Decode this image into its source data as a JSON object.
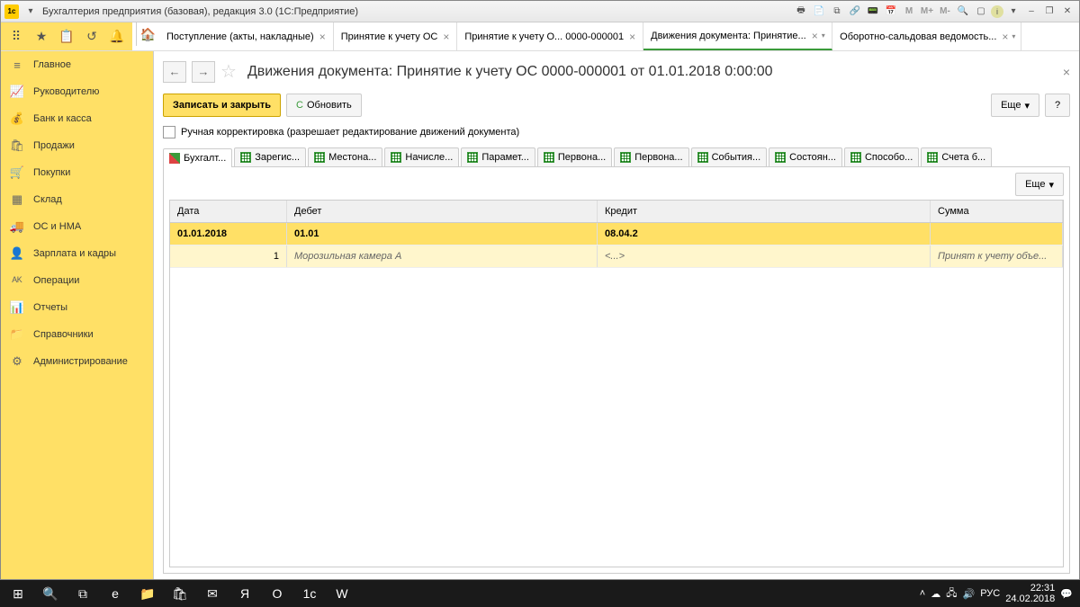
{
  "window_title": "Бухгалтерия предприятия (базовая), редакция 3.0  (1С:Предприятие)",
  "titlebar_icons": {
    "m1": "M",
    "m2": "M+",
    "m3": "M-",
    "i": "i"
  },
  "top_tabs": [
    {
      "label": "Поступление (акты, накладные)"
    },
    {
      "label": "Принятие к учету ОС"
    },
    {
      "label": "Принятие к учету О... 0000-000001"
    },
    {
      "label": "Движения документа: Принятие...",
      "active": true,
      "dd": true
    },
    {
      "label": "Оборотно-сальдовая ведомость...",
      "dd": true
    }
  ],
  "sidebar": [
    {
      "label": "Главное",
      "icon": "≡"
    },
    {
      "label": "Руководителю",
      "icon": "📈"
    },
    {
      "label": "Банк и касса",
      "icon": "💰"
    },
    {
      "label": "Продажи",
      "icon": "🛍"
    },
    {
      "label": "Покупки",
      "icon": "🛒"
    },
    {
      "label": "Склад",
      "icon": "▦"
    },
    {
      "label": "ОС и НМА",
      "icon": "🚚"
    },
    {
      "label": "Зарплата и кадры",
      "icon": "👤"
    },
    {
      "label": "Операции",
      "icon": "ᴬᴷ"
    },
    {
      "label": "Отчеты",
      "icon": "📊"
    },
    {
      "label": "Справочники",
      "icon": "📁"
    },
    {
      "label": "Администрирование",
      "icon": "⚙"
    }
  ],
  "page_title": "Движения документа: Принятие к учету ОС 0000-000001 от 01.01.2018 0:00:00",
  "buttons": {
    "save_close": "Записать и закрыть",
    "refresh": "Обновить",
    "more": "Еще",
    "help": "?"
  },
  "manual_edit": "Ручная корректировка (разрешает редактирование движений документа)",
  "sub_tabs": [
    {
      "label": "Бухгалт...",
      "icon": "dk",
      "active": true
    },
    {
      "label": "Зарегис...",
      "icon": "grid"
    },
    {
      "label": "Местона...",
      "icon": "grid"
    },
    {
      "label": "Начисле...",
      "icon": "grid"
    },
    {
      "label": "Парамет...",
      "icon": "grid"
    },
    {
      "label": "Первона...",
      "icon": "grid"
    },
    {
      "label": "Первона...",
      "icon": "grid"
    },
    {
      "label": "События...",
      "icon": "grid"
    },
    {
      "label": "Состоян...",
      "icon": "grid"
    },
    {
      "label": "Способо...",
      "icon": "grid"
    },
    {
      "label": "Счета б...",
      "icon": "grid"
    }
  ],
  "table": {
    "headers": {
      "date": "Дата",
      "debit": "Дебет",
      "credit": "Кредит",
      "sum": "Сумма"
    },
    "rows": [
      {
        "date": "01.01.2018",
        "debit": "01.01",
        "credit": "08.04.2",
        "sum": "",
        "class": "r1"
      },
      {
        "date": "1",
        "debit": "Морозильная камера А",
        "credit": "<...>",
        "sum": "Принят к учету объе...",
        "class": "r2",
        "num": true,
        "italic": true
      }
    ]
  },
  "panel_more": "Еще",
  "taskbar": {
    "lang": "РУС",
    "time": "22:31",
    "date": "24.02.2018"
  }
}
